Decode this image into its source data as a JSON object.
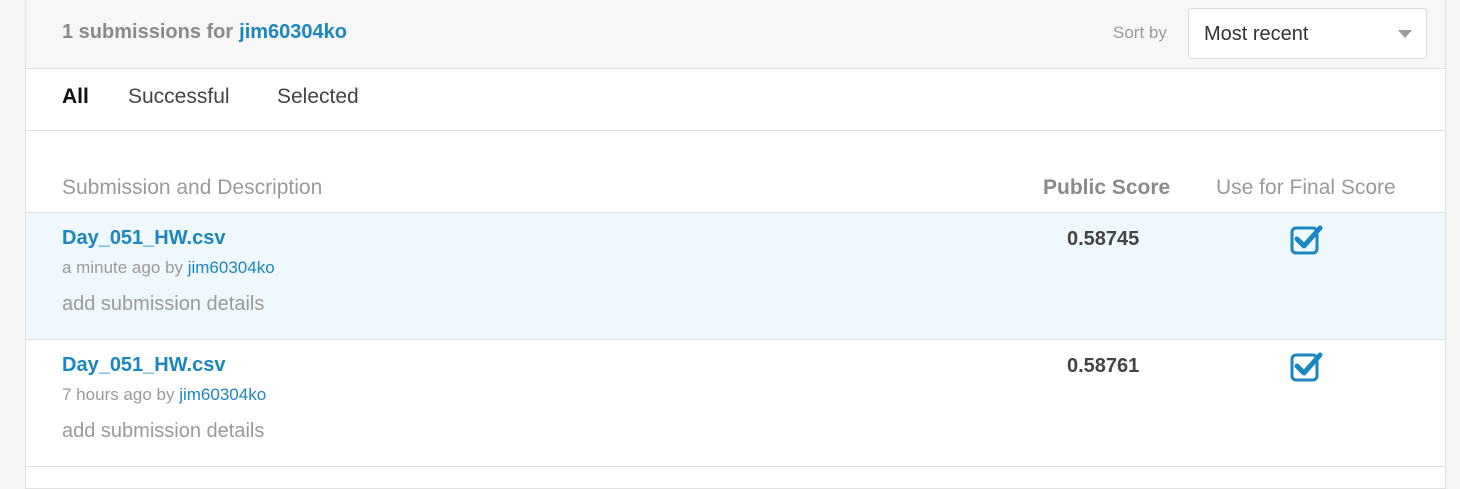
{
  "header": {
    "title_prefix": "1 submissions for",
    "username": "jim60304ko",
    "sort_label": "Sort by",
    "sort_value": "Most recent"
  },
  "tabs": [
    {
      "label": "All",
      "active": true
    },
    {
      "label": "Successful",
      "active": false
    },
    {
      "label": "Selected",
      "active": false
    }
  ],
  "columns": {
    "description": "Submission and Description",
    "public_score": "Public Score",
    "final_score": "Use for Final Score"
  },
  "submissions": [
    {
      "file": "Day_051_HW.csv",
      "time": "a minute ago by",
      "user": "jim60304ko",
      "details": "add submission details",
      "score": "0.58745",
      "selected": true
    },
    {
      "file": "Day_051_HW.csv",
      "time": "7 hours ago by",
      "user": "jim60304ko",
      "details": "add submission details",
      "score": "0.58761",
      "selected": true
    }
  ],
  "colors": {
    "accent": "#1b86c0",
    "highlight_row": "#eef8fd"
  },
  "icons": {
    "checkbox": "checked-checkbox-icon",
    "dropdown": "chevron-down-icon"
  }
}
